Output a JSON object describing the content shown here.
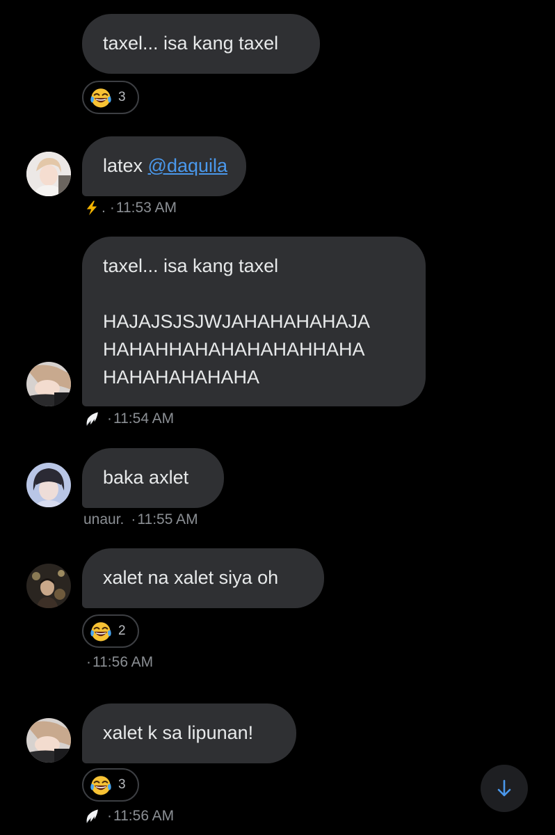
{
  "colors": {
    "background": "#000000",
    "bubble": "#2f3033",
    "text": "#e7e9ea",
    "meta": "#8b8f94",
    "mention": "#4a98ec",
    "scroll_arrow": "#4a98ec"
  },
  "messages": [
    {
      "id": "m1",
      "lines": [
        "taxel... isa kang taxel"
      ],
      "reaction": {
        "emoji": "face-with-tears-of-joy",
        "count": "3"
      }
    },
    {
      "id": "m2",
      "text_before_mention": "latex ",
      "mention": "@daquila",
      "meta": {
        "name_icon": "lightning-icon",
        "name": ".",
        "time": "11:53 AM"
      }
    },
    {
      "id": "m3",
      "lines": [
        "taxel... isa kang taxel",
        "",
        "HAJAJSJSJWJAHAHAHAHAJA",
        "HAHAHHAHAHAHAHAHHAHA",
        "HAHAHAHAHAHA"
      ],
      "meta": {
        "name_icon": "wing-icon",
        "name": "",
        "time": "11:54 AM"
      }
    },
    {
      "id": "m4",
      "lines": [
        "baka axlet"
      ],
      "meta": {
        "name": "unaur.",
        "time": "11:55 AM"
      }
    },
    {
      "id": "m5",
      "lines": [
        "xalet na xalet siya oh"
      ],
      "reaction": {
        "emoji": "face-with-tears-of-joy",
        "count": "2"
      },
      "meta": {
        "name": "",
        "time": "11:56 AM"
      }
    },
    {
      "id": "m6",
      "lines": [
        "xalet k sa lipunan!"
      ],
      "reaction": {
        "emoji": "face-with-tears-of-joy",
        "count": "3"
      },
      "meta": {
        "name_icon": "wing-icon",
        "name": "",
        "time": "11:56 AM"
      }
    }
  ],
  "meta_separator": "·",
  "scroll_button": {
    "icon": "arrow-down-icon"
  }
}
